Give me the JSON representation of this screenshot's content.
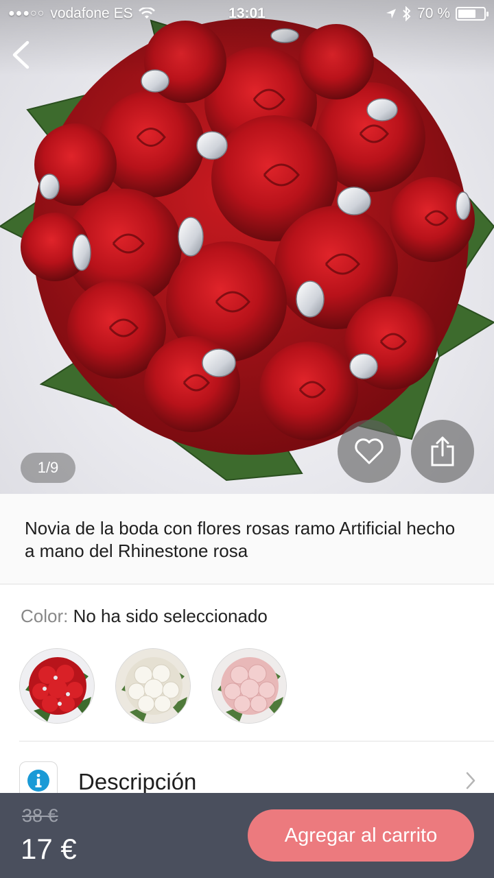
{
  "status_bar": {
    "signal": "●●●○○",
    "carrier": "vodafone ES",
    "time": "13:01",
    "battery_text": "70 %",
    "battery_level": 0.7
  },
  "gallery": {
    "pager": "1/9",
    "back_icon": "chevron-left-icon",
    "favorite_icon": "heart-icon",
    "share_icon": "share-icon"
  },
  "product": {
    "title": "Novia de la boda con flores rosas ramo Artificial hecho a mano del Rhinestone rosa"
  },
  "color": {
    "label": "Color:",
    "value": "No ha sido seleccionado",
    "swatches": [
      {
        "name": "red",
        "hex": "#c8161d"
      },
      {
        "name": "white",
        "hex": "#f2f0ea"
      },
      {
        "name": "pink",
        "hex": "#f0c9c8"
      }
    ]
  },
  "description": {
    "label": "Descripción",
    "icon": "info-icon",
    "chevron_icon": "chevron-right-icon"
  },
  "bottom_bar": {
    "old_price": "38 €",
    "price": "17 €",
    "add_to_cart": "Agregar al carrito"
  },
  "colors": {
    "accent": "#ec7a7e",
    "bar": "#4a4f5d",
    "info": "#1a9ad6"
  }
}
